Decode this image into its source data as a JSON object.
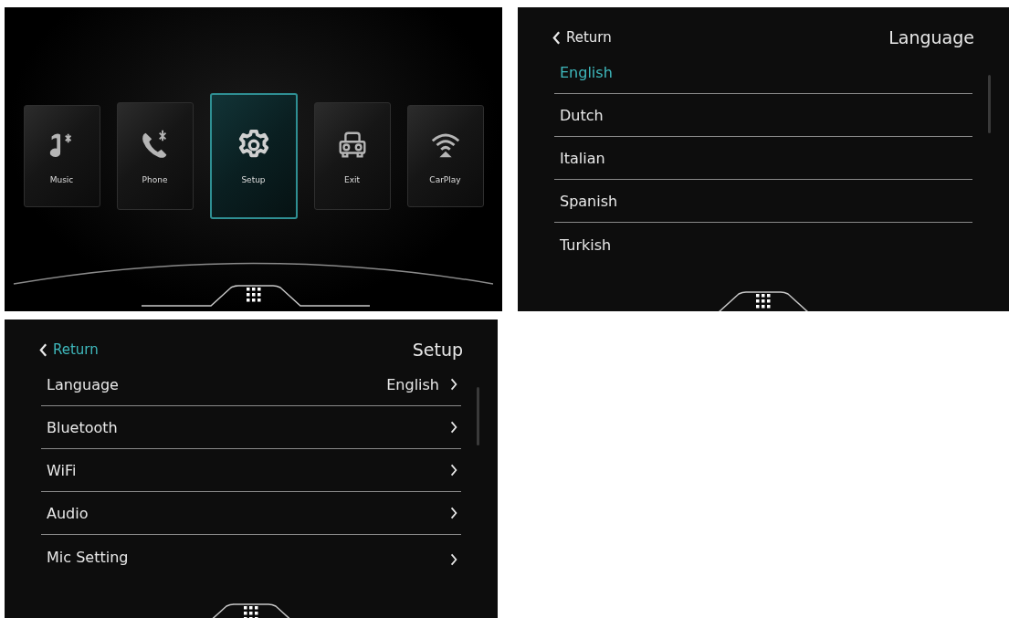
{
  "home_screen": {
    "tiles": [
      {
        "label": "Music",
        "selected": false
      },
      {
        "label": "Phone",
        "selected": false
      },
      {
        "label": "Setup",
        "selected": true
      },
      {
        "label": "Exit",
        "selected": false
      },
      {
        "label": "CarPlay",
        "selected": false
      }
    ]
  },
  "language_screen": {
    "return_button": {
      "label": "Return",
      "highlighted": false
    },
    "title": "Language",
    "items": [
      {
        "label": "English",
        "selected": true
      },
      {
        "label": "Dutch",
        "selected": false
      },
      {
        "label": "Italian",
        "selected": false
      },
      {
        "label": "Spanish",
        "selected": false
      },
      {
        "label": "Turkish",
        "selected": false
      }
    ]
  },
  "setup_screen": {
    "return_button": {
      "label": "Return",
      "highlighted": true
    },
    "title": "Setup",
    "items": [
      {
        "label": "Language",
        "value": "English"
      },
      {
        "label": "Bluetooth"
      },
      {
        "label": "WiFi"
      },
      {
        "label": "Audio"
      },
      {
        "label": "Mic Setting"
      }
    ]
  }
}
